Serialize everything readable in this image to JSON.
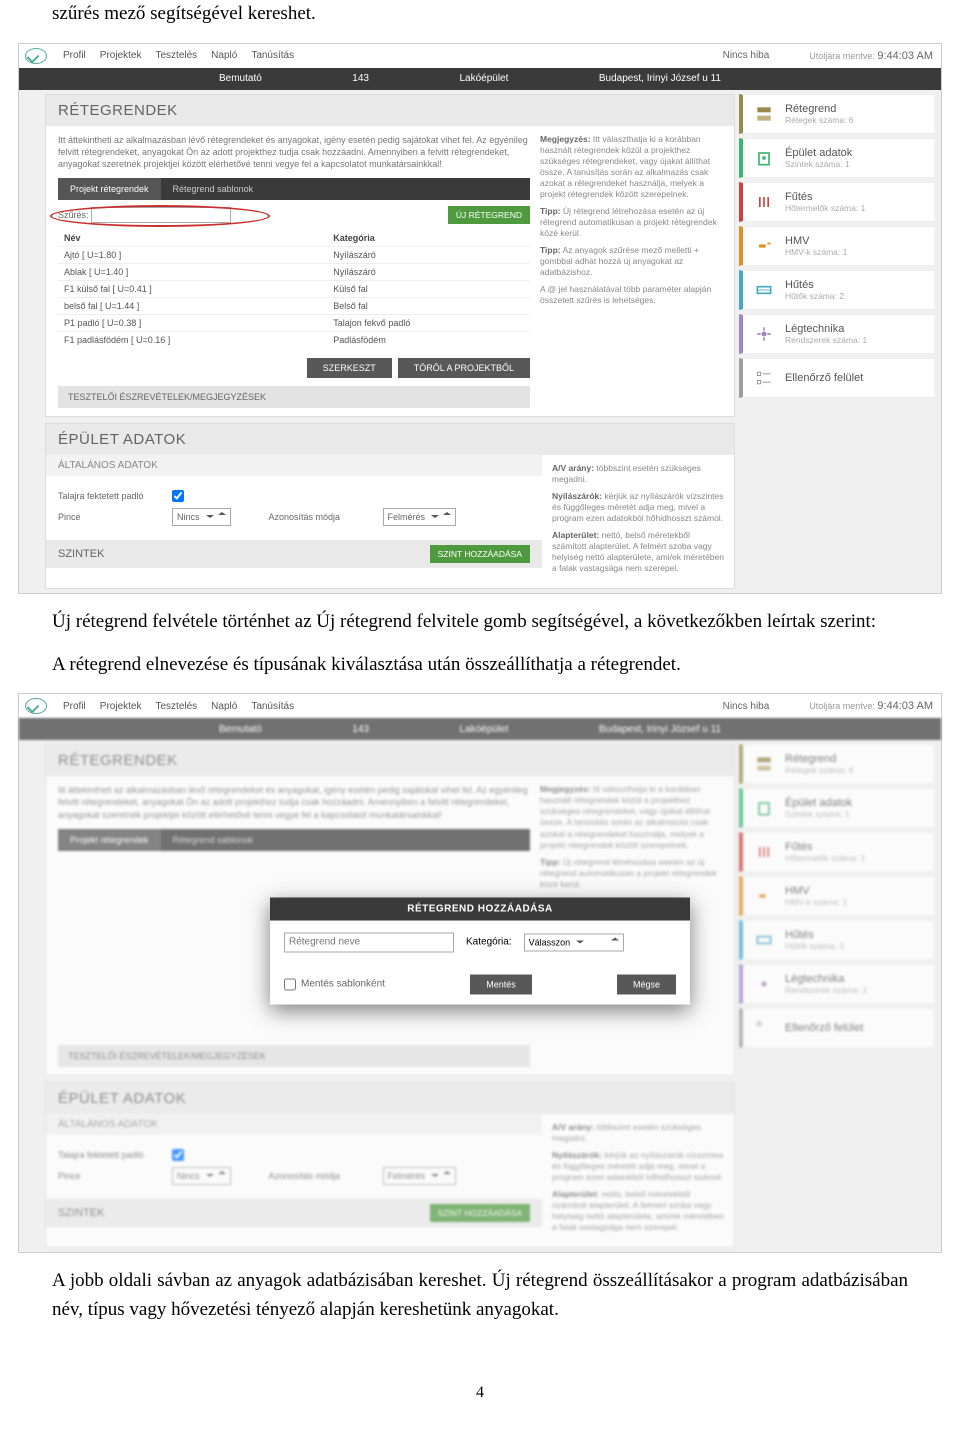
{
  "doc": {
    "intro": "szűrés mező segítségével kereshet.",
    "para1": "Új rétegrend felvétele történhet az Új rétegrend felvitele gomb segítségével, a következőkben leírtak szerint:",
    "para2": "A rétegrend elnevezése és típusának kiválasztása után összeállíthatja a rétegrendet.",
    "para3": "A jobb oldali sávban az anyagok adatbázisában kereshet. Új rétegrend összeállításakor a program adatbázisában név, típus vagy hővezetési tényező alapján kereshetünk anyagokat.",
    "page_num": "4"
  },
  "app": {
    "nav": {
      "profil": "Profil",
      "projektek": "Projektek",
      "teszteles": "Tesztelés",
      "naplo": "Napló",
      "tanusitas": "Tanúsítás"
    },
    "status": "Nincs hiba",
    "saved_label": "Utoljára mentve:",
    "saved_time": "9:44:03 AM",
    "sub": {
      "a": "Bemutató",
      "b": "143",
      "c": "Lakóépület",
      "d": "Budapest, Irinyi József u 11"
    },
    "retek": {
      "title": "RÉTEGRENDEK",
      "info": "Itt áttekintheti az alkalmazásban lévő rétegrendeket és anyagokat, igény esetén pedig sajátokat vihet fel. Az egyénileg felvitt rétegrendeket, anyagokat Ön az adott projekthez tudja csak hozzáadni. Amennyiben a felvitt rétegrendeket, anyagokat szeretnék projektjei között elérhetővé tenni vegye fel a kapcsolatot munkatársainkkal!",
      "tab1": "Projekt rétegrendek",
      "tab2": "Rétegrend sablonok",
      "filter_label": "Szűrés:",
      "new_btn": "ÚJ RÉTEGREND",
      "col_name": "Név",
      "col_cat": "Kategória",
      "rows": [
        {
          "n": "Ajtó [ U=1.80 ]",
          "k": "Nyílászáró"
        },
        {
          "n": "Ablak [ U=1.40 ]",
          "k": "Nyílászáró"
        },
        {
          "n": "F1 külső fal [ U=0.41 ]",
          "k": "Külső fal"
        },
        {
          "n": "belső fal [ U=1.44 ]",
          "k": "Belső fal"
        },
        {
          "n": "P1 padló [ U=0.38 ]",
          "k": "Talajon fekvő padló"
        },
        {
          "n": "F1 padlásfödém [ U=0.16 ]",
          "k": "Padlásfödém"
        }
      ],
      "btn_edit": "SZERKESZT",
      "btn_del": "TÖRÖL A PROJEKTBŐL",
      "tester": "TESZTELŐI ÉSZREVÉTELEK/MEGJEGYZÉSEK",
      "note_meg": "Megjegyzés:",
      "note_meg_txt": "Itt választhatja ki a korábban használt rétegrendek közül a projekthez szükséges rétegrendeket, vagy újakat állíthat össze. A tanúsítás során az alkalmazás csak azokat a rétegrendeket használja, melyek a projekt rétegrendek között szerepelnek.",
      "note_tipp1": "Tipp:",
      "note_tipp1_txt": "Új rétegrend létrehozása esetén az új rétegrend automatikusan a projekt rétegrendek közé kerül.",
      "note_tipp2": "Tipp:",
      "note_tipp2_txt": "Az anyagok szűrése mező melletti + gombbal adhat hozzá új anyagokat az adatbázishoz.",
      "note_a": "A @ jel használatával több paraméter alapján összetett szűrés is lehetséges."
    },
    "epul": {
      "title": "ÉPÜLET ADATOK",
      "sub": "ÁLTALÁNOS ADATOK",
      "f1_label": "Talajra fektetett padló",
      "f2_label": "Pince",
      "f2_val": "Nincs",
      "f3_label": "Azonosítás módja",
      "f3_val": "Felmérés",
      "szint": "SZINTEK",
      "szint_btn": "SZINT HOZZÁADÁSA",
      "note_av": "A/V arány:",
      "note_av_txt": "többszint esetén szükséges megadni.",
      "note_ny": "Nyílászárók:",
      "note_ny_txt": "kérjük az nyílászárók vízszintes és függőleges méretét adja meg, mivel a program ezen adatokból hőhidhosszt számol.",
      "note_al": "Alapterület:",
      "note_al_txt": "nettó, belső méretekből számított alapterület. A felmért szoba vagy helyiség nettó alapterülete, ami/ek méretében a falak vastagsága nem szerepel."
    },
    "side": {
      "retegrend": {
        "t": "Rétegrend",
        "s": "Rétegek száma: 6"
      },
      "epulet": {
        "t": "Épület adatok",
        "s": "Szintek száma: 1"
      },
      "futes": {
        "t": "Fűtés",
        "s": "Hőtermelők száma: 1"
      },
      "hmv": {
        "t": "HMV",
        "s": "HMV-k száma: 1"
      },
      "hutes": {
        "t": "Hűtés",
        "s": "Hűtők száma: 2"
      },
      "legt": {
        "t": "Légtechnika",
        "s": "Rendszerek száma: 1"
      },
      "ellen": {
        "t": "Ellenőrző felület",
        "s": ""
      }
    },
    "modal": {
      "title": "RÉTEGREND HOZZÁADÁSA",
      "ph": "Rétegrend neve",
      "cat_label": "Kategória:",
      "cat_val": "Válasszon",
      "save_tpl": "Mentés sablonként",
      "save": "Mentés",
      "cancel": "Mégse"
    }
  }
}
